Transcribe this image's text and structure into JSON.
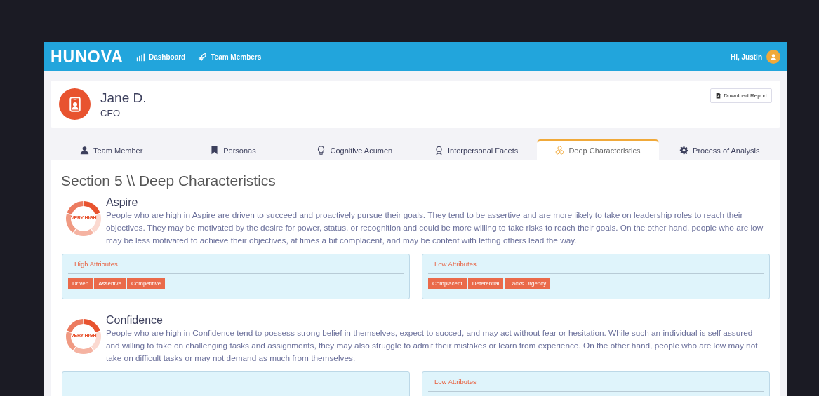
{
  "nav": {
    "logo": "HUNOVA",
    "items": [
      {
        "label": "Dashboard"
      },
      {
        "label": "Team Members"
      }
    ],
    "greeting": "Hi, Justin"
  },
  "profile": {
    "name": "Jane D.",
    "role": "CEO",
    "download_button": "Download Report"
  },
  "tabs": [
    {
      "label": "Team Member",
      "selected": false
    },
    {
      "label": "Personas",
      "selected": false
    },
    {
      "label": "Cognitive Acumen",
      "selected": false
    },
    {
      "label": "Interpersonal Facets",
      "selected": false
    },
    {
      "label": "Deep Characteristics",
      "selected": true
    },
    {
      "label": "Process of Analysis",
      "selected": false
    }
  ],
  "section_title": "Section 5 \\\\ Deep Characteristics",
  "traits": [
    {
      "name": "Aspire",
      "rating": "VERY HIGH",
      "description": "People who are high in Aspire are driven to succeed and proactively pursue their goals. They tend to be assertive and are more likely to take on leadership roles to reach their objectives. They may be motivated by the desire for power, status, or recognition and could be more willing to take risks to reach their goals. On the other hand, people who are low may be less motivated to achieve their objectives, at times a bit complacent, and may be content with letting others lead the way.",
      "high": {
        "title": "High Attributes",
        "tags": [
          "Driven",
          "Assertive",
          "Competitive"
        ]
      },
      "low": {
        "title": "Low Attributes",
        "tags": [
          "Complacent",
          "Deferential",
          "Lacks Urgency"
        ]
      }
    },
    {
      "name": "Confidence",
      "rating": "VERY HIGH",
      "description": "People who are high in Confidence tend to possess strong belief in themselves, expect to succed, and may act without fear or hesitation. While such an individual is self assured and willing to take on challenging tasks and assignments, they may also struggle to admit their mistakes or learn from experience. On the other hand, people who are low may not take on difficult tasks or may not demand as much from themselves.",
      "low": {
        "title": "Low Attributes"
      }
    }
  ]
}
